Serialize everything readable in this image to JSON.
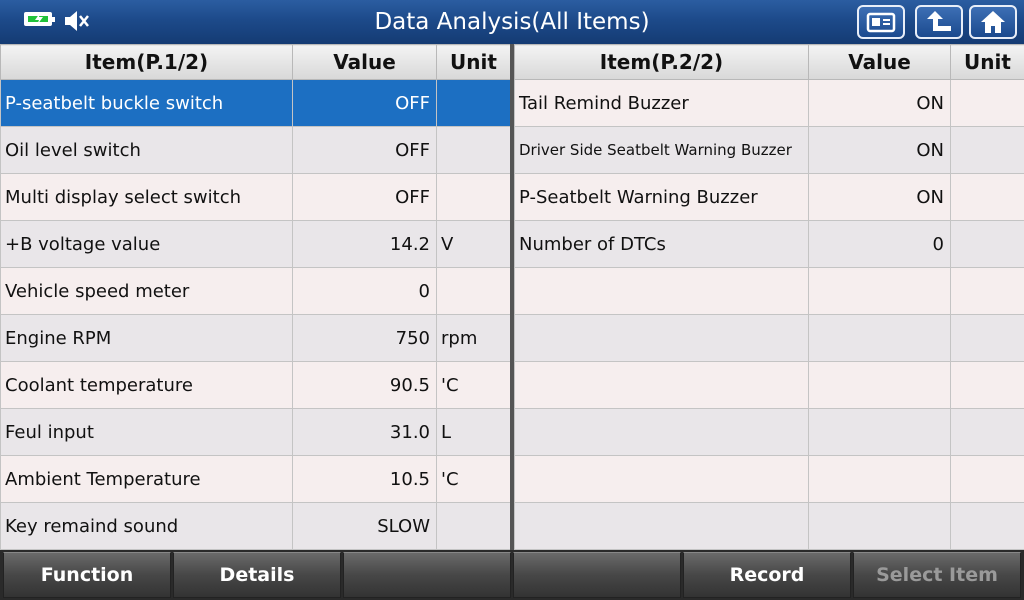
{
  "title": "Data Analysis(All Items)",
  "header_icons": {
    "battery": "battery-charging-icon",
    "sound": "mute-speaker-icon",
    "buttons": [
      "screenshot-icon",
      "back-arrow-icon",
      "home-icon"
    ]
  },
  "colors": {
    "title_bar": "#1d4a8a",
    "selected_row": "#1c6fc2",
    "charge_green": "#21c23a"
  },
  "left_table": {
    "headers": {
      "item": "Item(P.1/2)",
      "value": "Value",
      "unit": "Unit"
    },
    "rows": [
      {
        "item": "P-seatbelt buckle switch",
        "value": "OFF",
        "unit": ""
      },
      {
        "item": "Oil level switch",
        "value": "OFF",
        "unit": ""
      },
      {
        "item": "Multi display select switch",
        "value": "OFF",
        "unit": ""
      },
      {
        "item": "+B voltage value",
        "value": "14.2",
        "unit": "V"
      },
      {
        "item": "Vehicle speed meter",
        "value": "0",
        "unit": ""
      },
      {
        "item": "Engine RPM",
        "value": "750",
        "unit": "rpm"
      },
      {
        "item": "Coolant temperature",
        "value": "90.5",
        "unit": "'C"
      },
      {
        "item": "Feul input",
        "value": "31.0",
        "unit": "L"
      },
      {
        "item": "Ambient Temperature",
        "value": "10.5",
        "unit": "'C"
      },
      {
        "item": "Key remaind sound",
        "value": "SLOW",
        "unit": ""
      }
    ]
  },
  "right_table": {
    "headers": {
      "item": "Item(P.2/2)",
      "value": "Value",
      "unit": "Unit"
    },
    "rows": [
      {
        "item": "Tail Remind Buzzer",
        "value": "ON",
        "unit": ""
      },
      {
        "item": "Driver Side Seatbelt Warning Buzzer",
        "value": "ON",
        "unit": ""
      },
      {
        "item": "P-Seatbelt Warning Buzzer",
        "value": "ON",
        "unit": ""
      },
      {
        "item": "Number of DTCs",
        "value": "0",
        "unit": ""
      },
      {
        "item": "",
        "value": "",
        "unit": ""
      },
      {
        "item": "",
        "value": "",
        "unit": ""
      },
      {
        "item": "",
        "value": "",
        "unit": ""
      },
      {
        "item": "",
        "value": "",
        "unit": ""
      },
      {
        "item": "",
        "value": "",
        "unit": ""
      },
      {
        "item": "",
        "value": "",
        "unit": ""
      }
    ]
  },
  "bottom_buttons": [
    {
      "label": "Function",
      "enabled": true
    },
    {
      "label": "Details",
      "enabled": true
    },
    {
      "label": "",
      "enabled": true
    },
    {
      "label": "",
      "enabled": true
    },
    {
      "label": "Record",
      "enabled": true
    },
    {
      "label": "Select Item",
      "enabled": false
    }
  ]
}
